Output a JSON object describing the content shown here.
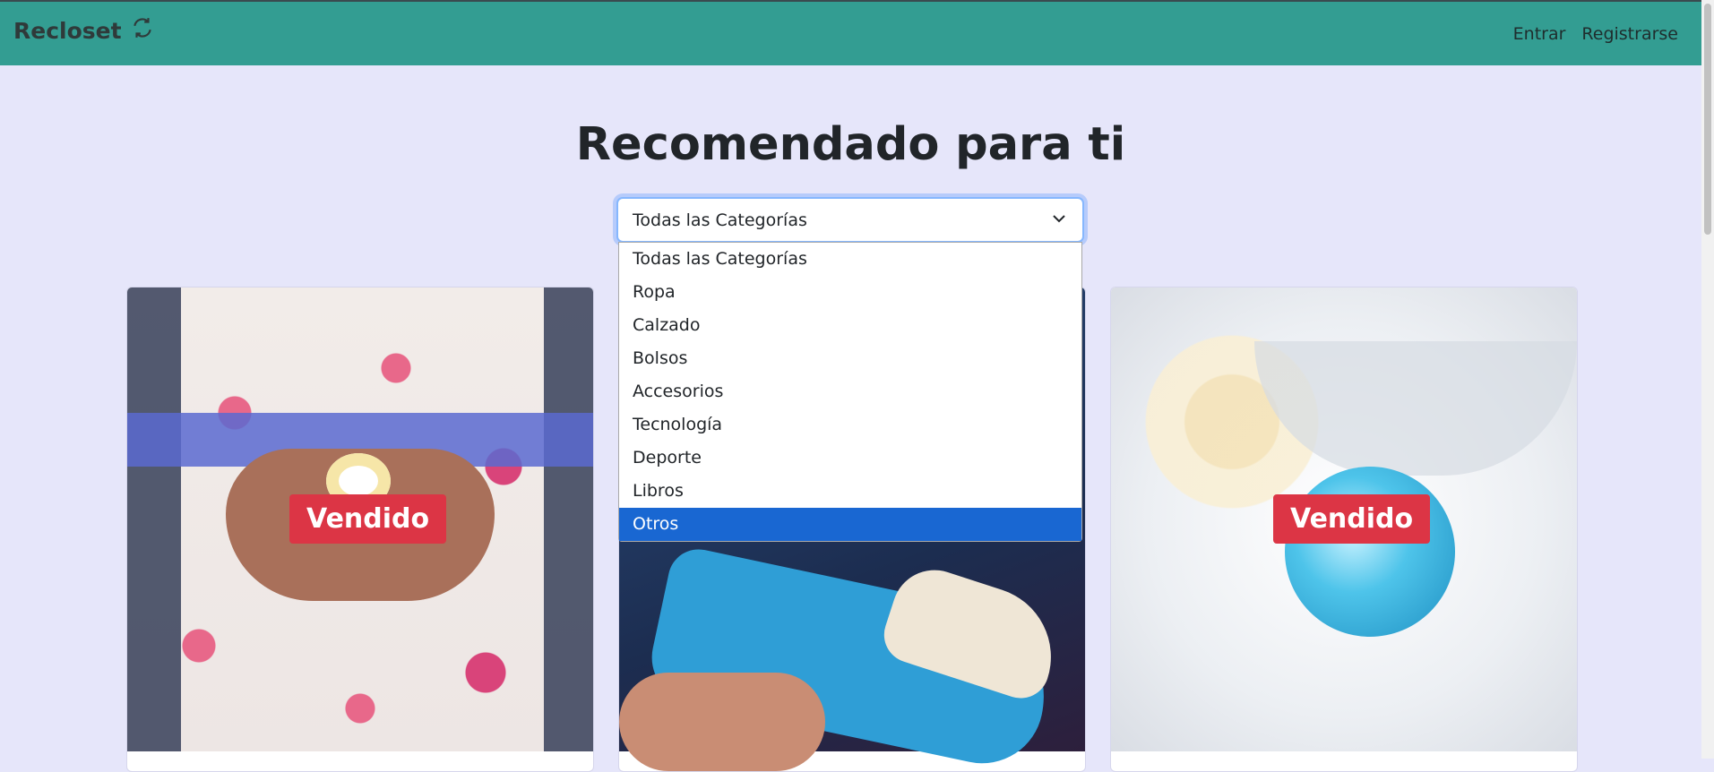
{
  "navbar": {
    "brand": "Recloset",
    "links": {
      "login": "Entrar",
      "register": "Registrarse"
    }
  },
  "main": {
    "title": "Recomendado para ti",
    "category_select": {
      "value": "Todas las Categorías",
      "options": [
        "Todas las Categorías",
        "Ropa",
        "Calzado",
        "Bolsos",
        "Accesorios",
        "Tecnología",
        "Deporte",
        "Libros",
        "Otros"
      ],
      "highlighted": "Otros"
    }
  },
  "products": [
    {
      "image": "floral-dress",
      "badge": "Vendido"
    },
    {
      "image": "blue-sneaker",
      "badge": ""
    },
    {
      "image": "blue-pendant",
      "badge": "Vendido"
    }
  ],
  "colors": {
    "navbar": "#339d92",
    "background": "#e6e6fa",
    "badge": "#dc3545",
    "selected_option": "#1967d2"
  }
}
